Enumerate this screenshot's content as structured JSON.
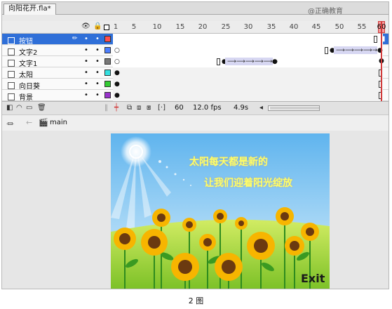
{
  "document_tab": {
    "label": "向阳花开.fla*"
  },
  "watermark": "@正确教育",
  "timeline": {
    "ruler_ticks": [
      "1",
      "5",
      "10",
      "15",
      "20",
      "25",
      "30",
      "35",
      "40",
      "45",
      "50",
      "55",
      "60"
    ],
    "layers": [
      {
        "name": "按钮",
        "selected": true,
        "color": "#ff4d4d"
      },
      {
        "name": "文字2",
        "selected": false,
        "color": "#4d7fff"
      },
      {
        "name": "文字1",
        "selected": false,
        "color": "#777777"
      },
      {
        "name": "太阳",
        "selected": false,
        "color": "#33e0e0"
      },
      {
        "name": "向日葵",
        "selected": false,
        "color": "#33cc33"
      },
      {
        "name": "背景",
        "selected": false,
        "color": "#9933cc"
      }
    ],
    "footer": {
      "frame": "60",
      "fps": "12.0 fps",
      "time": "4.9s"
    }
  },
  "edit_bar": {
    "scene": "main"
  },
  "stage": {
    "line1": "太阳每天都是新的",
    "line2": "让我们迎着阳光绽放",
    "exit_label": "Exit"
  },
  "caption": "2 图"
}
